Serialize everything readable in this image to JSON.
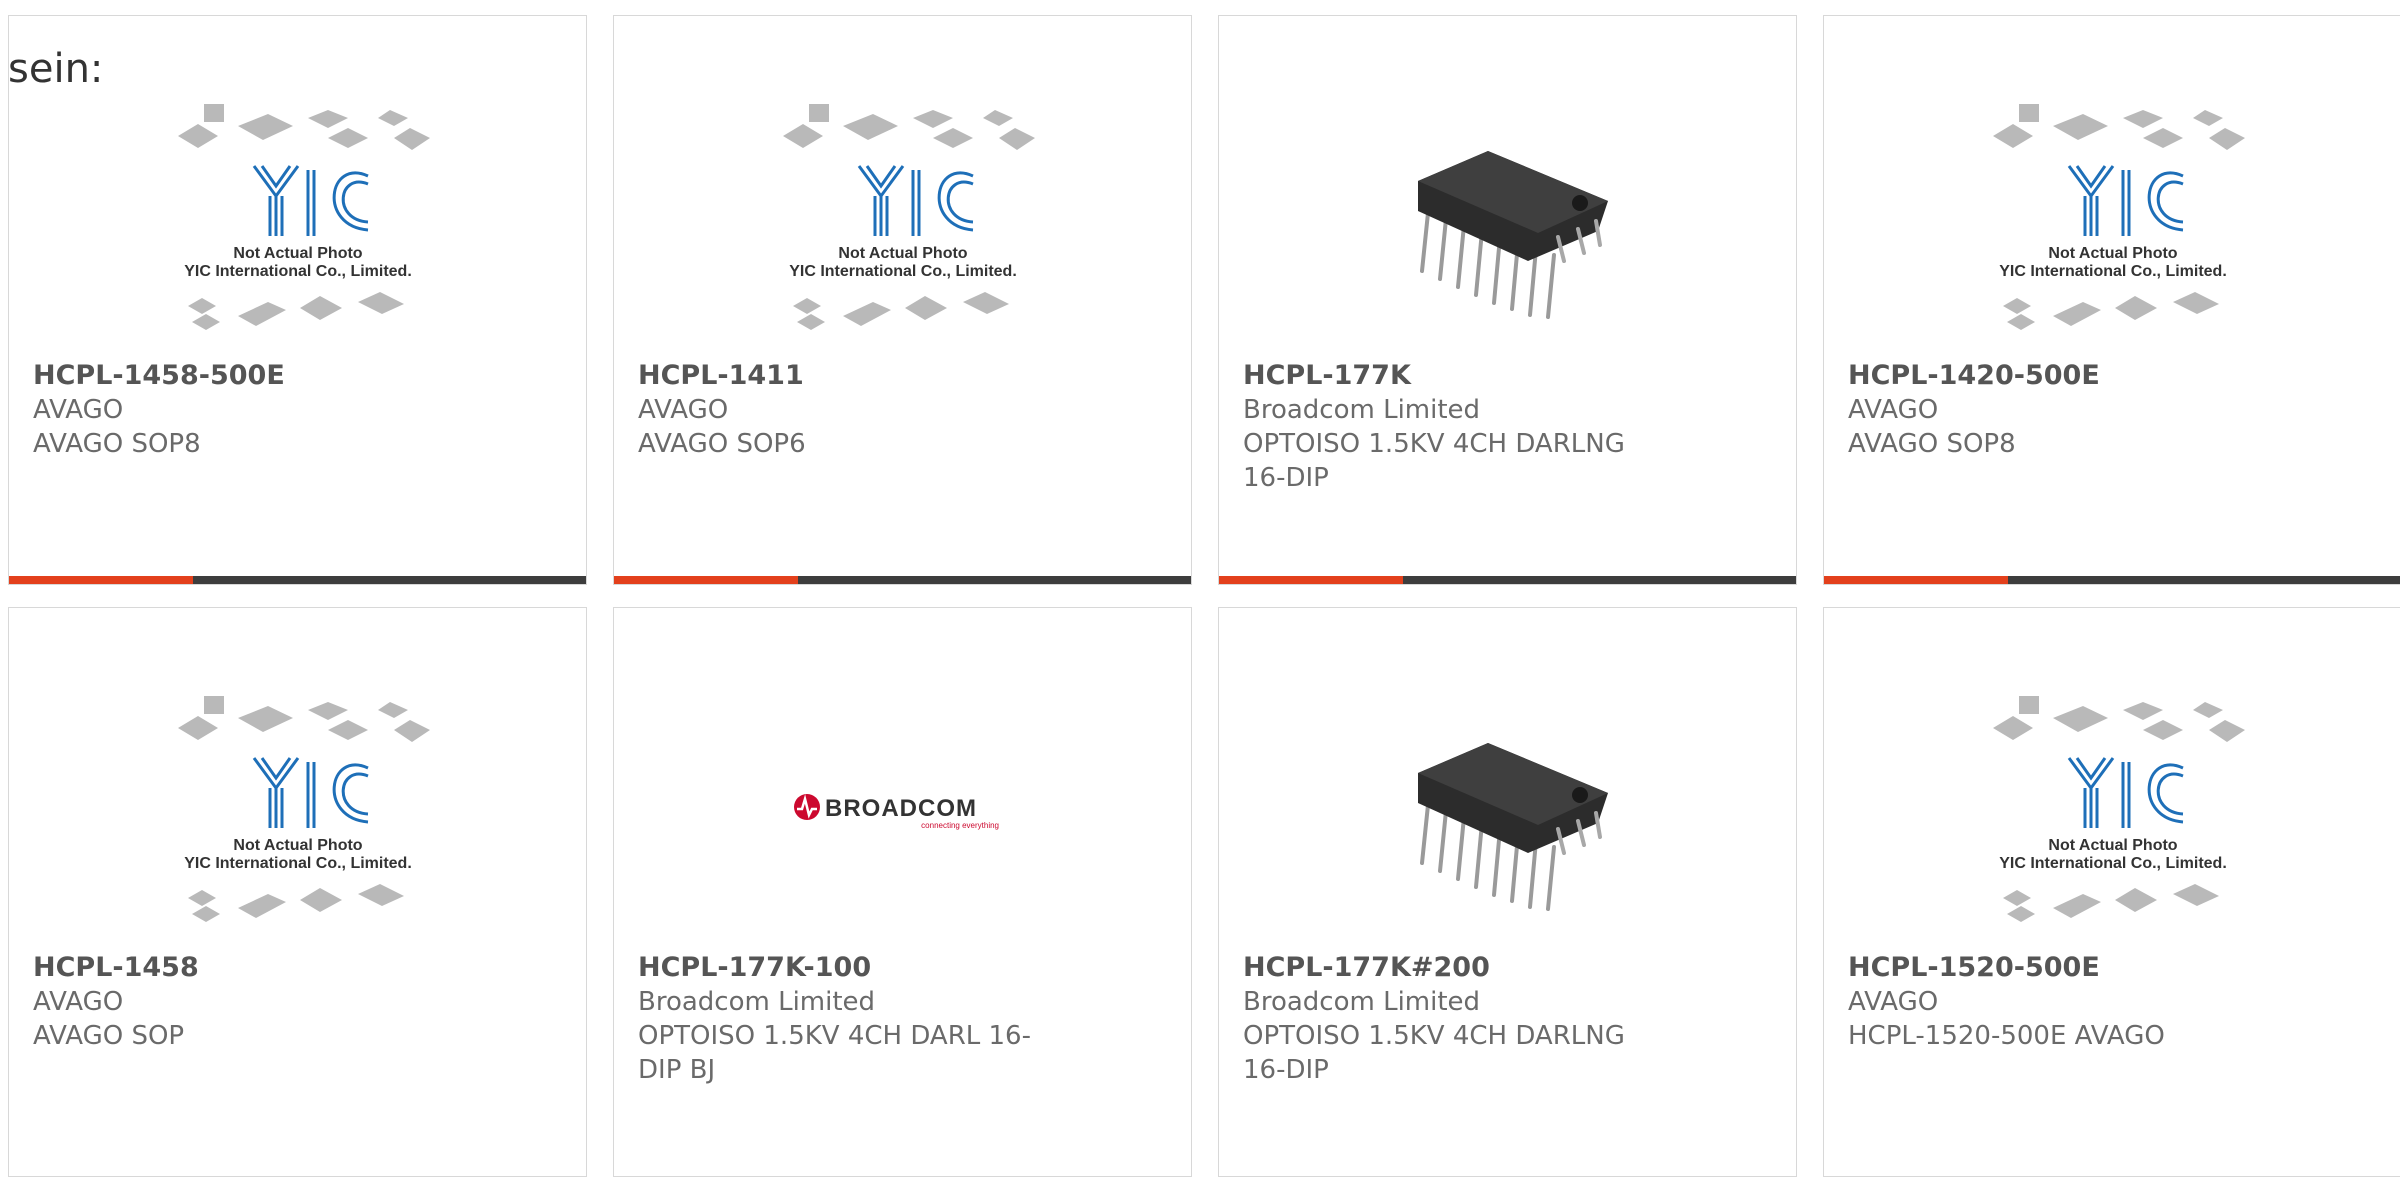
{
  "intro": "sein:",
  "colors": {
    "accent": "#e3401c",
    "bar": "#3d3d3d",
    "yic_blue": "#1e6fb8",
    "broadcom_red": "#cc092f"
  },
  "placeholder": {
    "caption1": "Not Actual Photo",
    "caption2": "YIC International Co., Limited."
  },
  "broadcom": {
    "name": "BROADCOM",
    "tagline": "connecting everything"
  },
  "products": [
    {
      "part": "HCPL-1458-500E",
      "manufacturer": "AVAGO",
      "description": "AVAGO SOP8",
      "image": "placeholder"
    },
    {
      "part": "HCPL-1411",
      "manufacturer": "AVAGO",
      "description": "AVAGO SOP6",
      "image": "placeholder"
    },
    {
      "part": "HCPL-177K",
      "manufacturer": "Broadcom Limited",
      "description": "OPTOISO 1.5KV 4CH DARLNG 16-DIP",
      "image": "dip-chip"
    },
    {
      "part": "HCPL-1420-500E",
      "manufacturer": "AVAGO",
      "description": "AVAGO SOP8",
      "image": "placeholder"
    },
    {
      "part": "HCPL-1458",
      "manufacturer": "AVAGO",
      "description": "AVAGO SOP",
      "image": "placeholder"
    },
    {
      "part": "HCPL-177K-100",
      "manufacturer": "Broadcom Limited",
      "description": "OPTOISO 1.5KV 4CH DARL 16-DIP BJ",
      "image": "broadcom-logo"
    },
    {
      "part": "HCPL-177K#200",
      "manufacturer": "Broadcom Limited",
      "description": "OPTOISO 1.5KV 4CH DARLNG 16-DIP",
      "image": "dip-chip"
    },
    {
      "part": "HCPL-1520-500E",
      "manufacturer": "AVAGO",
      "description": "HCPL-1520-500E AVAGO",
      "image": "placeholder"
    }
  ]
}
